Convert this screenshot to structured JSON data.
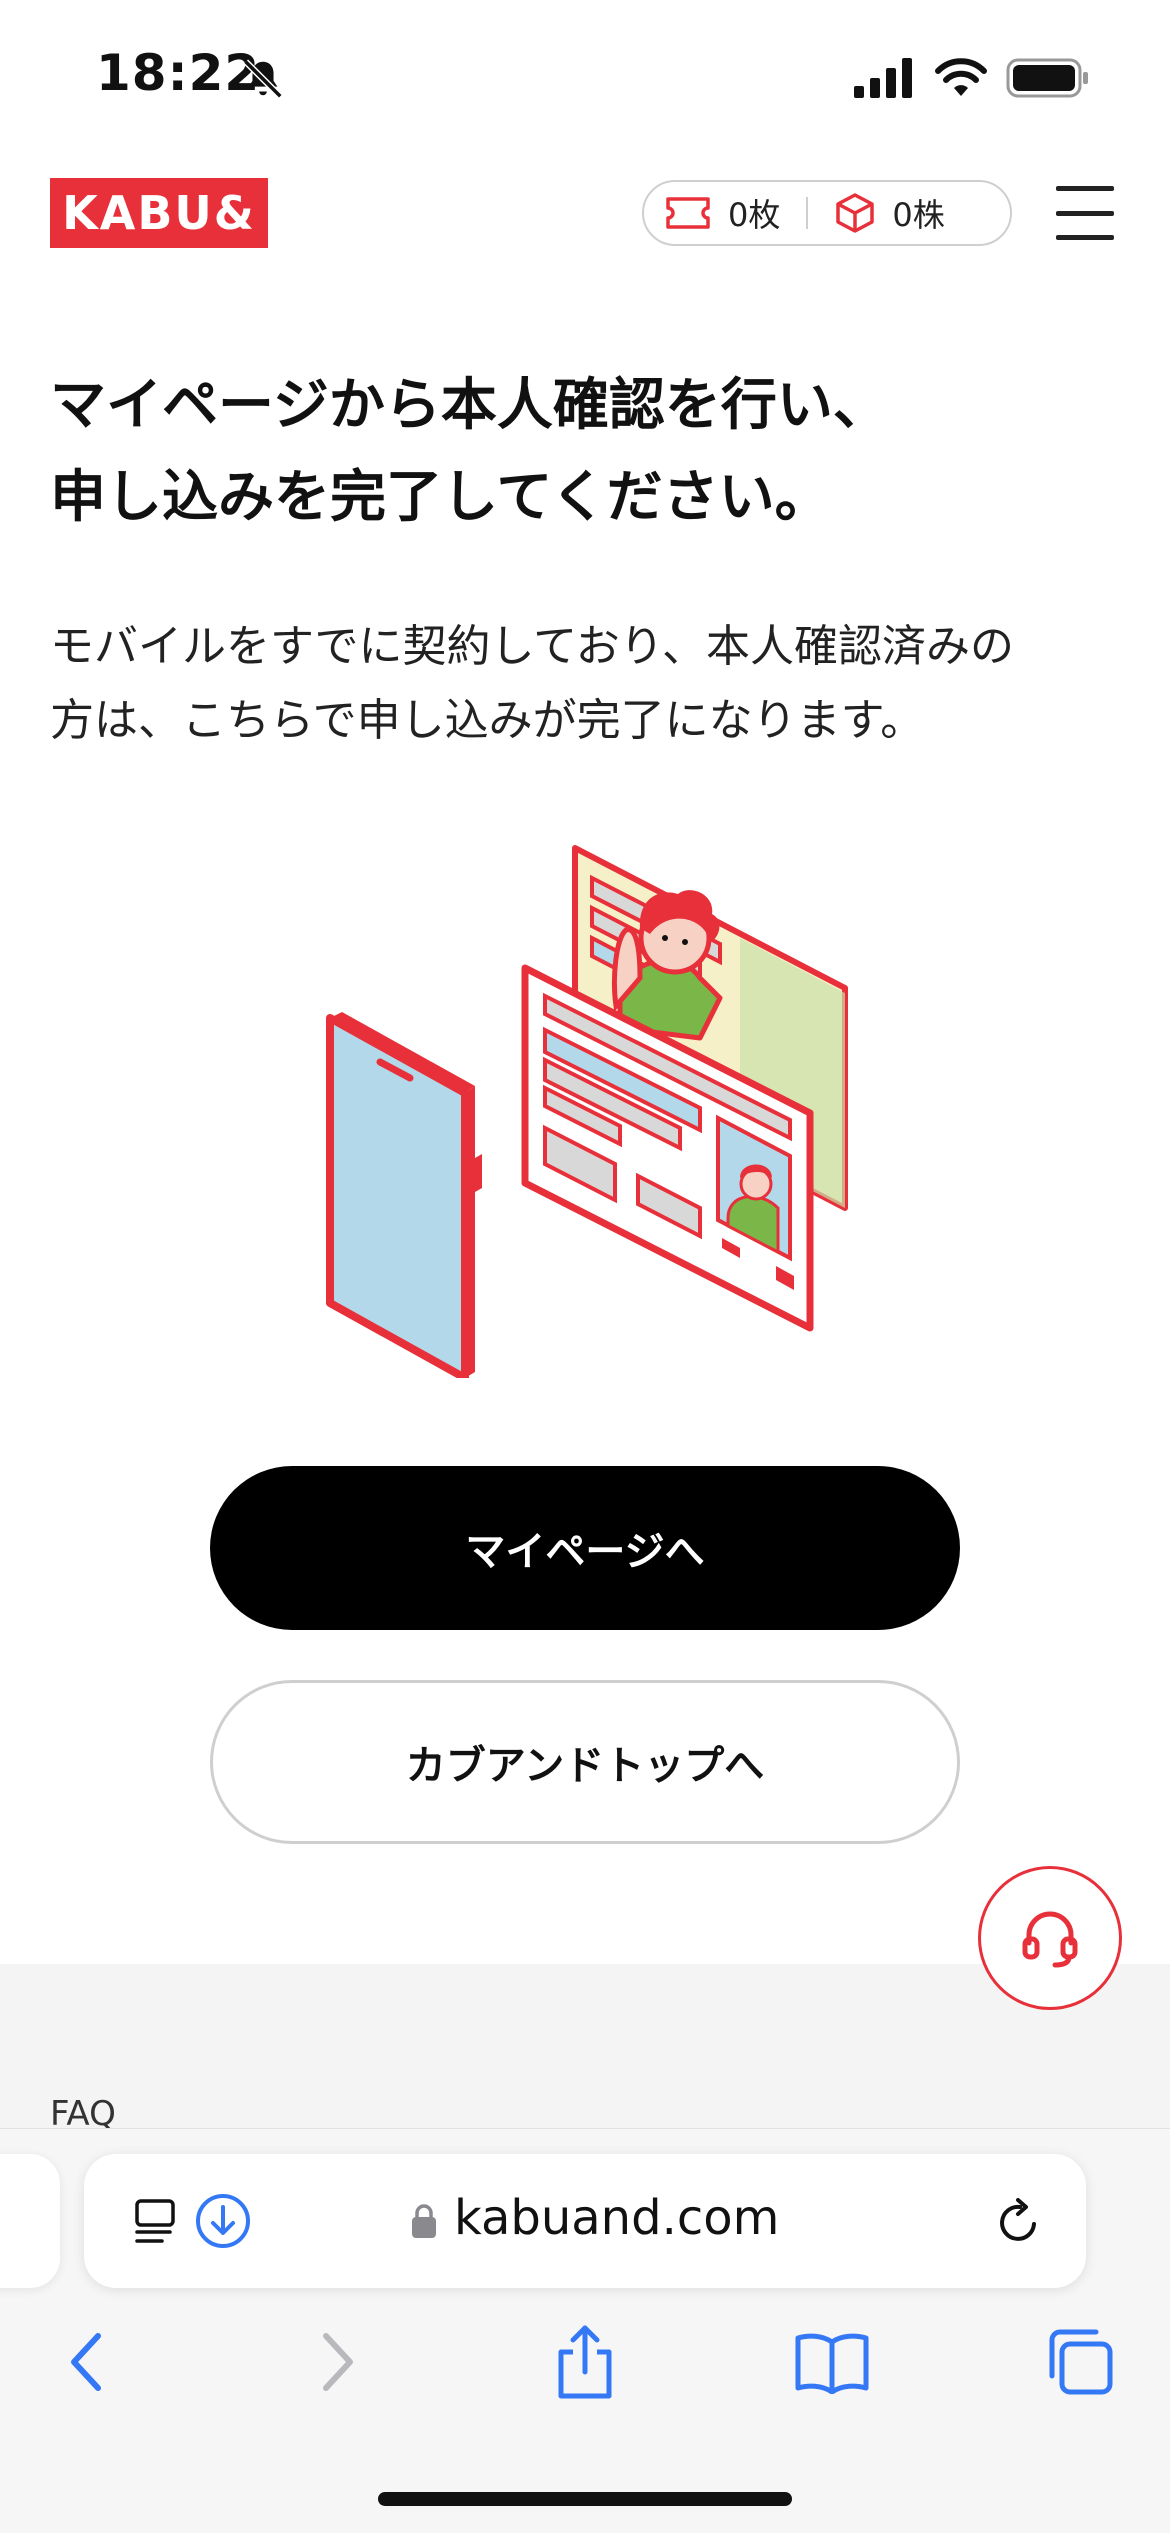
{
  "status_bar": {
    "time": "18:22",
    "icons": [
      "bell-slash-icon",
      "signal-icon",
      "wifi-icon",
      "battery-icon"
    ]
  },
  "header": {
    "logo_text": "KABU&",
    "ticket_count": "0枚",
    "stock_count": "0株",
    "icons": [
      "ticket-icon",
      "cube-icon",
      "menu-icon"
    ]
  },
  "main": {
    "heading_line1": "マイページから本人確認を行い、",
    "heading_line2": "申し込みを完了してください。",
    "desc_line1": "モバイルをすでに契約しており、本人確認済みの",
    "desc_line2": "方は、こちらで申し込みが完了になります。",
    "primary_button": "マイページへ",
    "secondary_button": "カブアンドトップへ"
  },
  "footer_section": {
    "faq_label": "FAQ"
  },
  "browser": {
    "url": "kabuand.com"
  },
  "colors": {
    "brand_red": "#e8303a",
    "primary_button": "#000000",
    "safari_blue": "#3478f6",
    "illustration_green": "#7ab648",
    "illustration_blue": "#b3d8ea"
  }
}
